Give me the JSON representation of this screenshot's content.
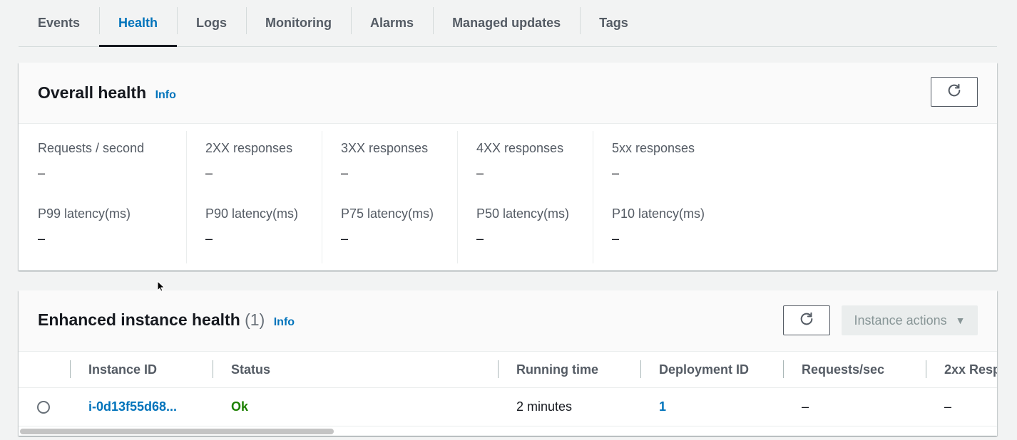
{
  "tabs": [
    {
      "label": "Events",
      "active": false
    },
    {
      "label": "Health",
      "active": true
    },
    {
      "label": "Logs",
      "active": false
    },
    {
      "label": "Monitoring",
      "active": false
    },
    {
      "label": "Alarms",
      "active": false
    },
    {
      "label": "Managed updates",
      "active": false
    },
    {
      "label": "Tags",
      "active": false
    }
  ],
  "overall": {
    "title": "Overall health",
    "info": "Info",
    "refresh_icon": "refresh-icon",
    "metrics": [
      {
        "label": "Requests / second",
        "value": "–"
      },
      {
        "label": "2XX responses",
        "value": "–"
      },
      {
        "label": "3XX responses",
        "value": "–"
      },
      {
        "label": "4XX responses",
        "value": "–"
      },
      {
        "label": "5xx responses",
        "value": "–"
      },
      {
        "label": "P99 latency(ms)",
        "value": "–"
      },
      {
        "label": "P90 latency(ms)",
        "value": "–"
      },
      {
        "label": "P75 latency(ms)",
        "value": "–"
      },
      {
        "label": "P50 latency(ms)",
        "value": "–"
      },
      {
        "label": "P10 latency(ms)",
        "value": "–"
      }
    ]
  },
  "enhanced": {
    "title": "Enhanced instance health",
    "count": "(1)",
    "info": "Info",
    "refresh_icon": "refresh-icon",
    "actions_label": "Instance actions",
    "actions_icon": "caret-down-icon",
    "columns": [
      "Instance ID",
      "Status",
      "Running time",
      "Deployment ID",
      "Requests/sec",
      "2xx Resp"
    ],
    "rows": [
      {
        "instance_id": "i-0d13f55d68...",
        "status": "Ok",
        "running_time": "2 minutes",
        "deployment_id": "1",
        "requests_sec": "–",
        "resp_2xx": "–"
      }
    ]
  },
  "colors": {
    "accent": "#0073bb",
    "ok": "#1d8102",
    "background": "#f2f3f3"
  }
}
